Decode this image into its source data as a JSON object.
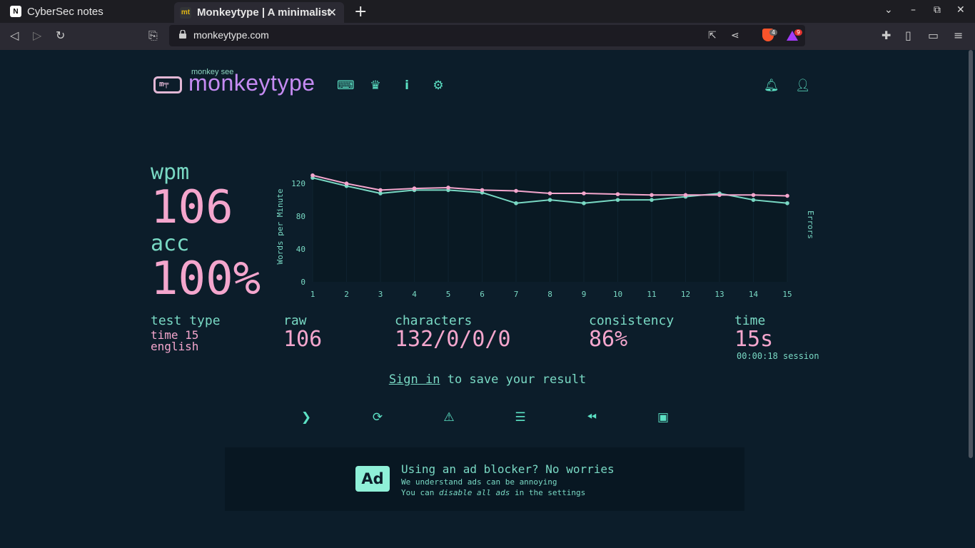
{
  "browser": {
    "tabs": [
      {
        "title": "CyberSec notes",
        "icon": "N"
      },
      {
        "title": "Monkeytype | A minimalist",
        "icon": "mt"
      }
    ],
    "url": "monkeytype.com",
    "brave_badge": "4",
    "rewards_badge": "9"
  },
  "site": {
    "logo_top": "monkey see",
    "logo_text": "monkeytype",
    "logo_mark": "m╤"
  },
  "result": {
    "wpm_label": "wpm",
    "wpm_value": "106",
    "acc_label": "acc",
    "acc_value": "100%",
    "test_type_label": "test type",
    "test_type_mode": "time 15",
    "test_type_language": "english",
    "raw_label": "raw",
    "raw_value": "106",
    "characters_label": "characters",
    "characters_value": "132/0/0/0",
    "consistency_label": "consistency",
    "consistency_value": "86%",
    "time_label": "time",
    "time_value": "15s",
    "session_text": "00:00:18 session"
  },
  "signin": {
    "link": "Sign in",
    "rest": " to save your result"
  },
  "ad": {
    "badge": "Ad",
    "title": "Using an ad blocker? No worries",
    "line1": "We understand ads can be annoying",
    "line2_pre": "You can ",
    "line2_em": "disable all ads",
    "line2_post": " in the settings"
  },
  "colors": {
    "bg": "#0c1d2a",
    "main": "#79d9c4",
    "accent": "#f4a6cd",
    "logo": "#c58bf2"
  },
  "chart_data": {
    "type": "line",
    "ylabel": "Words per Minute",
    "y2label": "Errors",
    "x": [
      1,
      2,
      3,
      4,
      5,
      6,
      7,
      8,
      9,
      10,
      11,
      12,
      13,
      14,
      15
    ],
    "ylim": [
      0,
      135
    ],
    "yticks": [
      0,
      40,
      80,
      120
    ],
    "series": [
      {
        "name": "wpm",
        "color": "#f4a6cd",
        "values": [
          130,
          120,
          112,
          114,
          115,
          112,
          111,
          108,
          108,
          107,
          106,
          106,
          106,
          106,
          105
        ]
      },
      {
        "name": "raw",
        "color": "#79d9c4",
        "values": [
          127,
          117,
          108,
          112,
          112,
          109,
          96,
          100,
          96,
          100,
          100,
          104,
          108,
          100,
          96
        ]
      }
    ]
  }
}
